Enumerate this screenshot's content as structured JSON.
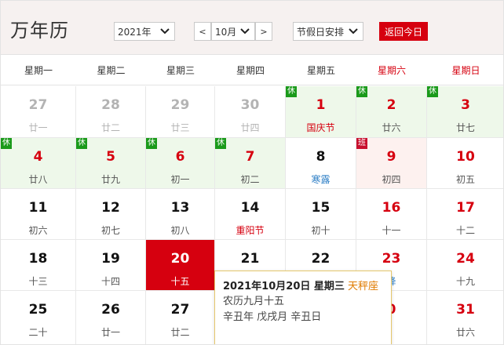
{
  "header": {
    "title": "万年历",
    "year": "2021年",
    "prev": "<",
    "month": "10月",
    "next": ">",
    "holiday": "节假日安排",
    "today": "返回今日"
  },
  "weekdays": [
    "星期一",
    "星期二",
    "星期三",
    "星期四",
    "星期五",
    "星期六",
    "星期日"
  ],
  "weeks": [
    [
      {
        "d": "27",
        "s": "廿一",
        "other": true
      },
      {
        "d": "28",
        "s": "廿二",
        "other": true
      },
      {
        "d": "29",
        "s": "廿三",
        "other": true
      },
      {
        "d": "30",
        "s": "廿四",
        "other": true
      },
      {
        "d": "1",
        "s": "国庆节",
        "rest": true,
        "badge": "休",
        "red": true,
        "sred": true
      },
      {
        "d": "2",
        "s": "廿六",
        "rest": true,
        "badge": "休",
        "red": true
      },
      {
        "d": "3",
        "s": "廿七",
        "rest": true,
        "badge": "休",
        "red": true
      }
    ],
    [
      {
        "d": "4",
        "s": "廿八",
        "rest": true,
        "badge": "休",
        "red": true
      },
      {
        "d": "5",
        "s": "廿九",
        "rest": true,
        "badge": "休",
        "red": true
      },
      {
        "d": "6",
        "s": "初一",
        "rest": true,
        "badge": "休",
        "red": true
      },
      {
        "d": "7",
        "s": "初二",
        "rest": true,
        "badge": "休",
        "red": true
      },
      {
        "d": "8",
        "s": "寒露",
        "sblue": true
      },
      {
        "d": "9",
        "s": "初四",
        "work": true,
        "badge": "班",
        "red": true
      },
      {
        "d": "10",
        "s": "初五",
        "red": true
      }
    ],
    [
      {
        "d": "11",
        "s": "初六"
      },
      {
        "d": "12",
        "s": "初七"
      },
      {
        "d": "13",
        "s": "初八"
      },
      {
        "d": "14",
        "s": "重阳节",
        "sred": true
      },
      {
        "d": "15",
        "s": "初十"
      },
      {
        "d": "16",
        "s": "十一",
        "red": true
      },
      {
        "d": "17",
        "s": "十二",
        "red": true
      }
    ],
    [
      {
        "d": "18",
        "s": "十三"
      },
      {
        "d": "19",
        "s": "十四"
      },
      {
        "d": "20",
        "s": "十五",
        "today": true
      },
      {
        "d": "21",
        "s": ""
      },
      {
        "d": "22",
        "s": ""
      },
      {
        "d": "23",
        "s": "降",
        "red": true,
        "sblue": true
      },
      {
        "d": "24",
        "s": "十九",
        "red": true
      }
    ],
    [
      {
        "d": "25",
        "s": "二十"
      },
      {
        "d": "26",
        "s": "廿一"
      },
      {
        "d": "27",
        "s": "廿二"
      },
      {
        "d": "",
        "s": ""
      },
      {
        "d": "",
        "s": ""
      },
      {
        "d": "0",
        "s": "",
        "red": true
      },
      {
        "d": "31",
        "s": "廿六",
        "red": true
      }
    ]
  ],
  "popup": {
    "date": "2021年10月20日 星期三",
    "zodiac": "天秤座",
    "lunar": "农历九月十五",
    "ganzhi": "辛丑年 戊戌月 辛丑日"
  }
}
